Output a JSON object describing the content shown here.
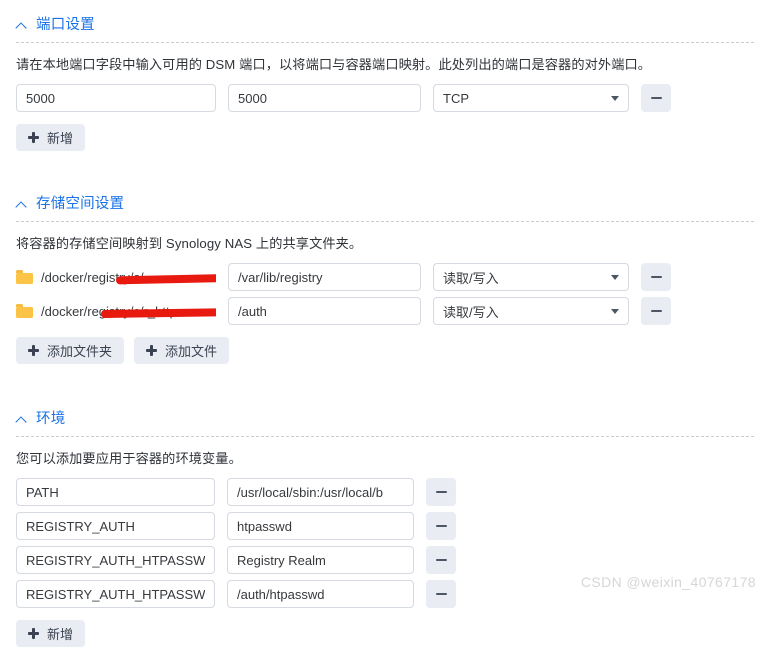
{
  "sections": {
    "port": {
      "title": "端口设置",
      "collapse_icon": "chevron-up-icon",
      "description": "请在本地端口字段中输入可用的 DSM 端口，以将端口与容器端口映射。此处列出的端口是容器的对外端口。",
      "rows": [
        {
          "local_port": "5000",
          "container_port": "5000",
          "type": "TCP"
        }
      ],
      "add_label": "新增",
      "remove_icon": "minus-icon"
    },
    "storage": {
      "title": "存储空间设置",
      "collapse_icon": "chevron-up-icon",
      "description": "将容器的存储空间映射到 Synology NAS 上的共享文件夹。",
      "rows": [
        {
          "folder": "/docker/registry/s/...",
          "folder_redacted": true,
          "mount_path": "/var/lib/registry",
          "permission": "读取/写入"
        },
        {
          "folder": "/docker/registry/s/r_http...",
          "folder_redacted": true,
          "mount_path": "/auth",
          "permission": "读取/写入"
        }
      ],
      "add_folder_label": "添加文件夹",
      "add_file_label": "添加文件",
      "remove_icon": "minus-icon"
    },
    "env": {
      "title": "环境",
      "collapse_icon": "chevron-up-icon",
      "description": "您可以添加要应用于容器的环境变量。",
      "rows": [
        {
          "key": "PATH",
          "value": "/usr/local/sbin:/usr/local/b"
        },
        {
          "key": "REGISTRY_AUTH",
          "value": "htpasswd"
        },
        {
          "key": "REGISTRY_AUTH_HTPASSW",
          "value": "Registry Realm"
        },
        {
          "key": "REGISTRY_AUTH_HTPASSW",
          "value": "/auth/htpasswd"
        }
      ],
      "add_label": "新增",
      "remove_icon": "minus-icon"
    }
  },
  "watermark": "CSDN @weixin_40767178",
  "colors": {
    "accent": "#1a72e8",
    "button_bg": "#e9edf3",
    "folder": "#fbc447",
    "redaction": "#e8190f",
    "field_border": "#d4dae0"
  }
}
